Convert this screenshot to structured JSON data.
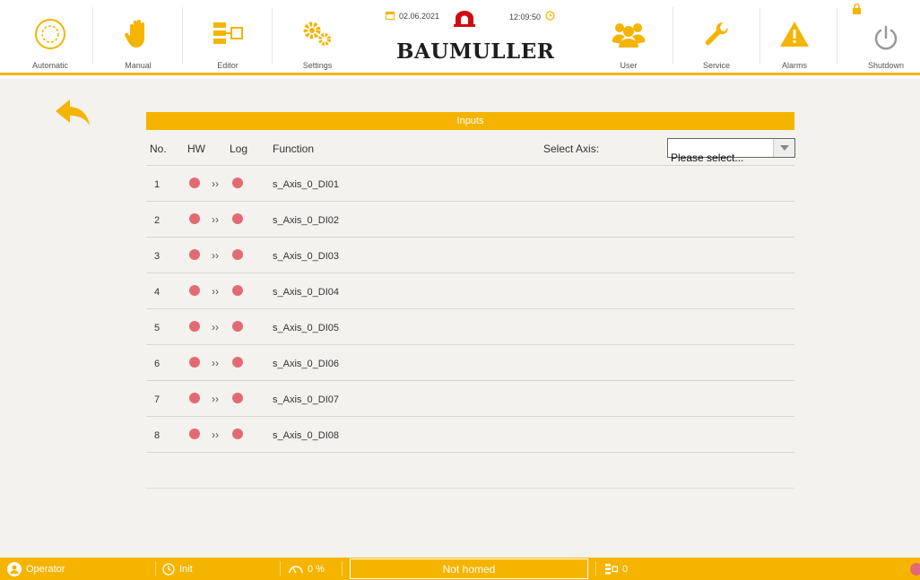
{
  "toolbar": {
    "automatic": "Automatic",
    "manual": "Manual",
    "editor": "Editor",
    "settings": "Settings",
    "user": "User",
    "service": "Service",
    "alarms": "Alarms",
    "shutdown": "Shutdown"
  },
  "brand": {
    "date": "02.06.2021",
    "time": "12:09:50",
    "logo": "BAUMULLER"
  },
  "colors": {
    "accent": "#f5b400",
    "led_off": "#e26b73",
    "background": "#f4f2ef"
  },
  "inputs": {
    "title": "Inputs",
    "columns": {
      "no": "No.",
      "hw": "HW",
      "log": "Log",
      "function": "Function"
    },
    "select_axis_label": "Select Axis:",
    "select_axis_value": "Please select...",
    "rows": [
      {
        "no": "1",
        "arrow": "››",
        "function": "s_Axis_0_DI01"
      },
      {
        "no": "2",
        "arrow": "››",
        "function": "s_Axis_0_DI02"
      },
      {
        "no": "3",
        "arrow": "››",
        "function": "s_Axis_0_DI03"
      },
      {
        "no": "4",
        "arrow": "››",
        "function": "s_Axis_0_DI04"
      },
      {
        "no": "5",
        "arrow": "››",
        "function": "s_Axis_0_DI05"
      },
      {
        "no": "6",
        "arrow": "››",
        "function": "s_Axis_0_DI06"
      },
      {
        "no": "7",
        "arrow": "››",
        "function": "s_Axis_0_DI07"
      },
      {
        "no": "8",
        "arrow": "››",
        "function": "s_Axis_0_DI08"
      }
    ]
  },
  "statusbar": {
    "user": "Operator",
    "state": "Init",
    "override": "0 %",
    "homing": "Not homed",
    "program_count": "0"
  }
}
